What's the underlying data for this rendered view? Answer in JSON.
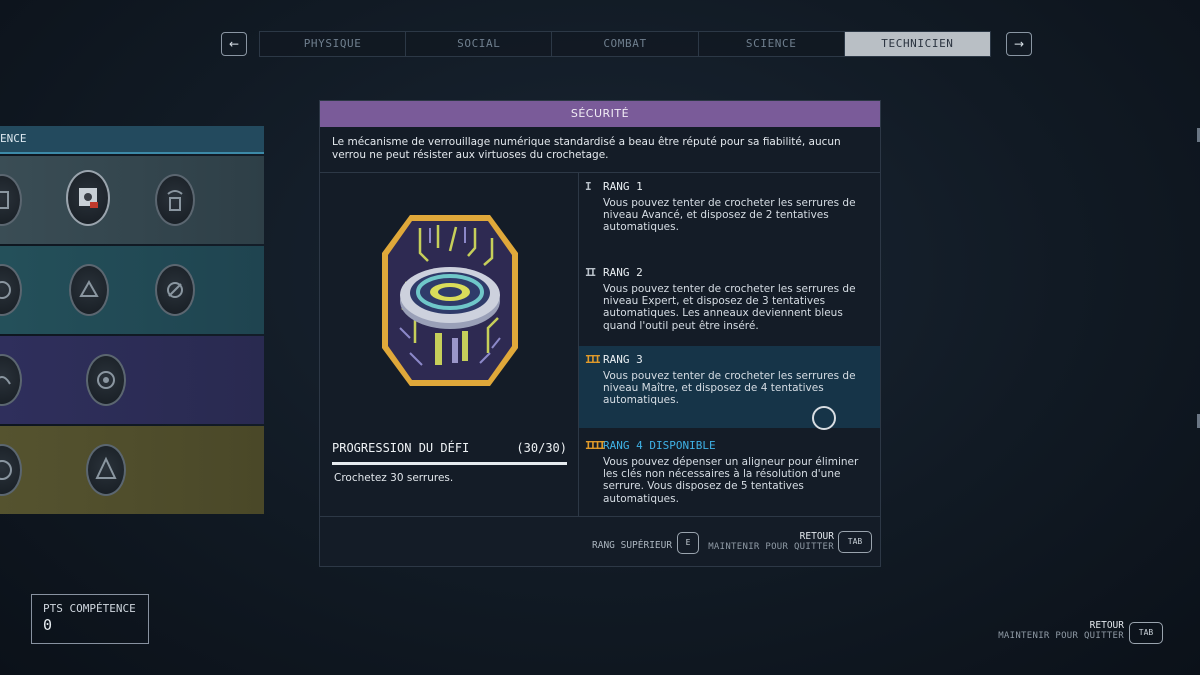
{
  "nav": {
    "prev": "←",
    "next": "→"
  },
  "tabs": [
    {
      "label": "PHYSIQUE",
      "active": false
    },
    {
      "label": "SOCIAL",
      "active": false
    },
    {
      "label": "COMBAT",
      "active": false
    },
    {
      "label": "SCIENCE",
      "active": false
    },
    {
      "label": "TECHNICIEN",
      "active": true
    }
  ],
  "tree": {
    "header": "ENCE"
  },
  "panel": {
    "title": "SÉCURITÉ",
    "description": "Le mécanisme de verrouillage numérique standardisé a beau être réputé pour sa fiabilité, aucun verrou ne peut résister aux virtuoses du crochetage.",
    "progress": {
      "title": "PROGRESSION DU DÉFI",
      "count": "(30/30)",
      "fraction": 1.0,
      "description": "Crochetez 30 serrures."
    },
    "ranks": [
      {
        "mark": "I",
        "title": "RANG 1",
        "description": "Vous pouvez tenter de crocheter les serrures de niveau Avancé, et disposez de 2 tentatives automatiques."
      },
      {
        "mark": "II",
        "title": "RANG 2",
        "description": "Vous pouvez tenter de crocheter les serrures de niveau Expert, et disposez de 3 tentatives automatiques. Les anneaux deviennent bleus quand l'outil peut être inséré."
      },
      {
        "mark": "III",
        "title": "RANG 3",
        "description": "Vous pouvez tenter de crocheter les serrures de niveau Maître, et disposez de 4 tentatives automatiques."
      },
      {
        "mark": "IIII",
        "title": "RANG 4 DISPONIBLE",
        "description": "Vous pouvez dépenser un aligneur pour éliminer les clés non nécessaires à la résolution d'une serrure. Vous disposez de 5 tentatives automatiques."
      }
    ],
    "footer": {
      "rank_up_label": "RANG SUPÉRIEUR",
      "rank_up_key": "E",
      "back_label": "RETOUR",
      "hold_label": "MAINTENIR POUR QUITTER",
      "back_key": "TAB"
    }
  },
  "skill_points": {
    "label": "PTS COMPÉTENCE",
    "value": "0"
  },
  "bottom_right": {
    "back_label": "RETOUR",
    "hold_label": "MAINTENIR POUR QUITTER",
    "key": "TAB"
  },
  "colors": {
    "accent_purple": "#7a5b99",
    "rank_orange": "#e09a2a",
    "available_blue": "#3fb2e6"
  }
}
